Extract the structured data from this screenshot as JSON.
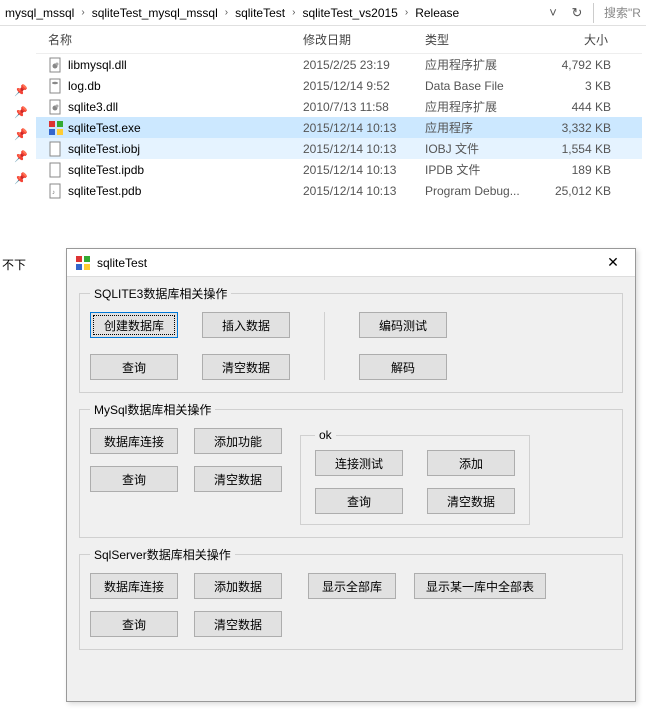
{
  "breadcrumb": [
    "mysql_mssql",
    "sqliteTest_mysql_mssql",
    "sqliteTest",
    "sqliteTest_vs2015",
    "Release"
  ],
  "search_placeholder": "搜索\"R",
  "columns": {
    "name": "名称",
    "date": "修改日期",
    "type": "类型",
    "size": "大小"
  },
  "files": [
    {
      "icon": "dll",
      "name": "libmysql.dll",
      "date": "2015/2/25 23:19",
      "type": "应用程序扩展",
      "size": "4,792 KB",
      "state": ""
    },
    {
      "icon": "db",
      "name": "log.db",
      "date": "2015/12/14 9:52",
      "type": "Data Base File",
      "size": "3 KB",
      "state": ""
    },
    {
      "icon": "dll",
      "name": "sqlite3.dll",
      "date": "2010/7/13 11:58",
      "type": "应用程序扩展",
      "size": "444 KB",
      "state": ""
    },
    {
      "icon": "exe",
      "name": "sqliteTest.exe",
      "date": "2015/12/14 10:13",
      "type": "应用程序",
      "size": "3,332 KB",
      "state": "selected"
    },
    {
      "icon": "file",
      "name": "sqliteTest.iobj",
      "date": "2015/12/14 10:13",
      "type": "IOBJ 文件",
      "size": "1,554 KB",
      "state": "hover"
    },
    {
      "icon": "file",
      "name": "sqliteTest.ipdb",
      "date": "2015/12/14 10:13",
      "type": "IPDB 文件",
      "size": "189 KB",
      "state": ""
    },
    {
      "icon": "pdb",
      "name": "sqliteTest.pdb",
      "date": "2015/12/14 10:13",
      "type": "Program Debug...",
      "size": "25,012 KB",
      "state": ""
    }
  ],
  "truncated_text": "不下",
  "dialog": {
    "title": "sqliteTest",
    "group1_title": "SQLITE3数据库相关操作",
    "btn_create_db": "创建数据库",
    "btn_insert": "插入数据",
    "btn_query": "查询",
    "btn_clear": "清空数据",
    "btn_encode_test": "编码测试",
    "btn_decode": "解码",
    "group2_title": "MySql数据库相关操作",
    "btn_db_connect": "数据库连接",
    "btn_add_feature": "添加功能",
    "group2_ok_title": "ok",
    "btn_conn_test": "连接测试",
    "btn_add": "添加",
    "group3_title": "SqlServer数据库相关操作",
    "btn_add_data": "添加数据",
    "btn_show_all_db": "显示全部库",
    "btn_show_tables": "显示某一库中全部表"
  }
}
